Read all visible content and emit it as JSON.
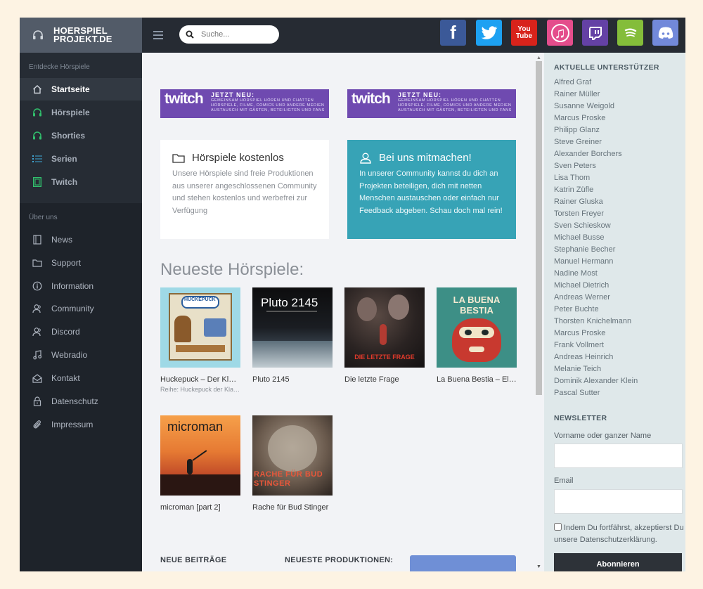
{
  "brand": {
    "line1": "HOERSPIEL",
    "line2": "PROJEKT.DE"
  },
  "search": {
    "placeholder": "Suche..."
  },
  "social": [
    {
      "name": "facebook",
      "glyph": "f",
      "color": "#3b5998"
    },
    {
      "name": "twitter",
      "glyph": "t",
      "color": "#1da1f2"
    },
    {
      "name": "youtube",
      "glyph": "You Tube",
      "color": "#d8231b"
    },
    {
      "name": "itunes",
      "glyph": "♫",
      "color": "#e44d8c"
    },
    {
      "name": "twitch",
      "glyph": "▣",
      "color": "#6441a5"
    },
    {
      "name": "spotify",
      "glyph": "≋",
      "color": "#84bd3a"
    },
    {
      "name": "discord",
      "glyph": "◉",
      "color": "#7289da"
    }
  ],
  "sidebar": {
    "section1_title": "Entdecke Hörspiele",
    "section1": [
      {
        "label": "Startseite",
        "icon": "home-icon"
      },
      {
        "label": "Hörspiele",
        "icon": "headphones-icon"
      },
      {
        "label": "Shorties",
        "icon": "headphones-icon"
      },
      {
        "label": "Serien",
        "icon": "list-icon"
      },
      {
        "label": "Twitch",
        "icon": "film-icon"
      }
    ],
    "section2_title": "Über uns",
    "section2": [
      {
        "label": "News",
        "icon": "book-icon"
      },
      {
        "label": "Support",
        "icon": "folder-icon"
      },
      {
        "label": "Information",
        "icon": "info-icon"
      },
      {
        "label": "Community",
        "icon": "users-icon"
      },
      {
        "label": "Discord",
        "icon": "users-icon"
      },
      {
        "label": "Webradio",
        "icon": "music-icon"
      },
      {
        "label": "Kontakt",
        "icon": "mail-icon"
      },
      {
        "label": "Datenschutz",
        "icon": "lock-icon"
      },
      {
        "label": "Impressum",
        "icon": "paperclip-icon"
      }
    ]
  },
  "banners": [
    {
      "logo": "twitch",
      "headline": "JETZT NEU:",
      "text": "GEMEINSAM HÖRSPIEL HÖREN UND CHATTEN HÖRSPIELE, FILME, COMICS UND ANDERE MEDIEN AUSTAUSCH MIT GÄSTEN, BETEILIGTEN UND FANS"
    },
    {
      "logo": "twitch",
      "headline": "JETZT NEU:",
      "text": "GEMEINSAM HÖRSPIEL HÖREN UND CHATTEN HÖRSPIELE, FILME, COMICS UND ANDERE MEDIEN AUSTAUSCH MIT GÄSTEN, BETEILIGTEN UND FANS"
    }
  ],
  "cards": {
    "free": {
      "title": "Hörspiele kostenlos",
      "text": "Unsere Hörspiele sind freie Produktionen aus unserer angeschlossenen Community und stehen kostenlos und werbefrei zur Verfügung"
    },
    "join": {
      "title": "Bei uns mitmachen!",
      "text": "In unserer Community kannst du dich an Projekten beteiligen, dich mit netten Menschen austauschen oder einfach nur Feedback abgeben. Schau doch mal rein!"
    }
  },
  "latest": {
    "title": "Neueste Hörspiele:",
    "items": [
      {
        "title": "Huckepuck – Der Klassenfahrt",
        "subtitle": "Reihe: Huckepuck der Klassiker",
        "cover_text": "HUCKEPUCK",
        "cover_bg": "#9fd9e6"
      },
      {
        "title": "Pluto 2145",
        "subtitle": "",
        "cover_text": "Pluto 2145",
        "cover_bg": "#1e2a33"
      },
      {
        "title": "Die letzte Frage",
        "subtitle": "",
        "cover_text": "DIE LETZTE FRAGE",
        "cover_bg": "#2a2322"
      },
      {
        "title": "La Buena Bestia – El Monstruo",
        "subtitle": "",
        "cover_text": "LA BUENA BESTIA",
        "cover_bg": "#3d8f86"
      },
      {
        "title": "microman [part 2]",
        "subtitle": "",
        "cover_text": "microman",
        "cover_bg": "#e67a33"
      },
      {
        "title": "Rache für Bud Stinger",
        "subtitle": "",
        "cover_text": "RACHE FÜR BUD STINGER",
        "cover_bg": "#6a5a4d"
      }
    ]
  },
  "footer": {
    "posts": "NEUE BEITRÄGE",
    "productions": "NEUESTE PRODUKTIONEN:"
  },
  "supporters": {
    "title": "AKTUELLE UNTERSTÜTZER",
    "names": [
      "Alfred Graf",
      "Rainer Müller",
      "Susanne Weigold",
      "Marcus Proske",
      "Philipp Glanz",
      "Steve Greiner",
      "Alexander Borchers",
      "Sven Peters",
      "Lisa Thom",
      "Katrin Züfle",
      "Rainer Gluska",
      "Torsten Freyer",
      "Sven Schieskow",
      "Michael Busse",
      "Stephanie Becher",
      "Manuel Hermann",
      "Nadine Most",
      "Michael Dietrich",
      "Andreas Werner",
      "Peter Buchte",
      "Thorsten Knichelmann",
      "Marcus Proske",
      "Frank Vollmert",
      "Andreas Heinrich",
      "Melanie Teich",
      "Dominik Alexander Klein",
      "Pascal Sutter"
    ]
  },
  "newsletter": {
    "title": "NEWSLETTER",
    "name_label": "Vorname oder ganzer Name",
    "email_label": "Email",
    "consent": "Indem Du fortfährst, akzeptierst Du unsere Datenschutzerklärung.",
    "button": "Abonnieren"
  }
}
